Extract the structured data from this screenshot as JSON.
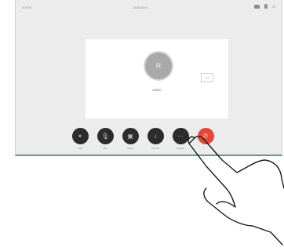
{
  "status": {
    "left": "00000",
    "center": "0000  00:0",
    "time": "00"
  },
  "call": {
    "avatar_initial": "R",
    "caller_name": "00000",
    "self_view_label": "000"
  },
  "controls": [
    {
      "label": "Hold",
      "glyph": "⏸"
    },
    {
      "label": "Mic",
      "glyph": "🎙"
    },
    {
      "label": "Share",
      "glyph": "▣"
    },
    {
      "label": "Volume",
      "glyph": "♪"
    },
    {
      "label": "Keypad",
      "glyph": "⋯"
    },
    {
      "label": "",
      "glyph": "✆"
    }
  ],
  "colors": {
    "end_call": "#e5473a",
    "accent_line": "#5f9e86",
    "button": "#2c2c2c"
  }
}
